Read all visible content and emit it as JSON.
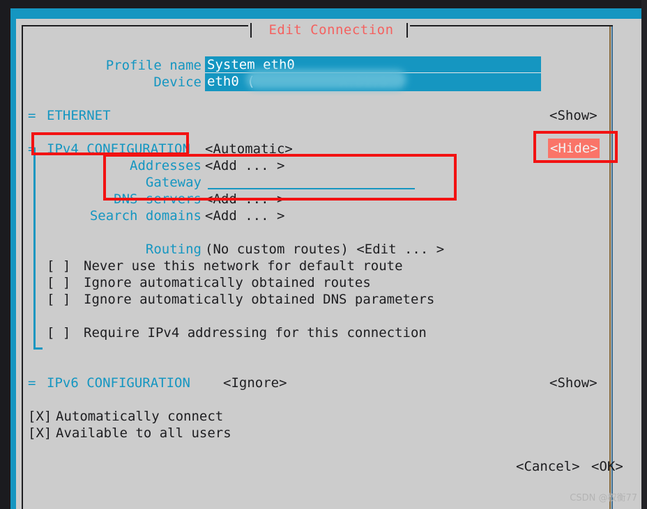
{
  "window": {
    "title": "Edit Connection",
    "title_color": "#f4615f",
    "surface_color": "#cccccc",
    "terminal_bg": "#1596c1",
    "accent_color": "#1596c1",
    "annotation_color": "#f21212"
  },
  "fields": {
    "profile_name": {
      "label": "Profile name",
      "value": "System eth0"
    },
    "device": {
      "label": "Device",
      "value": "eth0 (",
      "value_redacted": "A:D1:9",
      "value_tail": ")"
    }
  },
  "sections": {
    "ethernet": {
      "marker": "=",
      "label": "ETHERNET",
      "toggle": "<Show>"
    },
    "ipv4": {
      "marker": "=",
      "label": "IPv4 CONFIGURATION",
      "method": "<Automatic>",
      "toggle": "<Hide>",
      "rows": [
        {
          "label": "Addresses",
          "value": "<Add ... >"
        },
        {
          "label": "Gateway",
          "value": ""
        },
        {
          "label": "DNS servers",
          "value": "<Add ... >"
        },
        {
          "label": "Search domains",
          "value": "<Add ... >"
        }
      ],
      "routing": {
        "label": "Routing",
        "value": "(No custom routes) <Edit ... >"
      },
      "checkboxes": [
        {
          "box": "[ ]",
          "label": "Never use this network for default route"
        },
        {
          "box": "[ ]",
          "label": "Ignore automatically obtained routes"
        },
        {
          "box": "[ ]",
          "label": "Ignore automatically obtained DNS parameters"
        },
        {
          "box": "[ ]",
          "label": "Require IPv4 addressing for this connection"
        }
      ]
    },
    "ipv6": {
      "marker": "=",
      "label": "IPv6 CONFIGURATION",
      "method": "<Ignore>",
      "toggle": "<Show>"
    }
  },
  "global_checkboxes": [
    {
      "box": "[X]",
      "label": "Automatically connect"
    },
    {
      "box": "[X]",
      "label": "Available to all users"
    }
  ],
  "buttons": {
    "cancel": "<Cancel>",
    "ok": "<OK>"
  },
  "watermark": "CSDN @权衡77"
}
